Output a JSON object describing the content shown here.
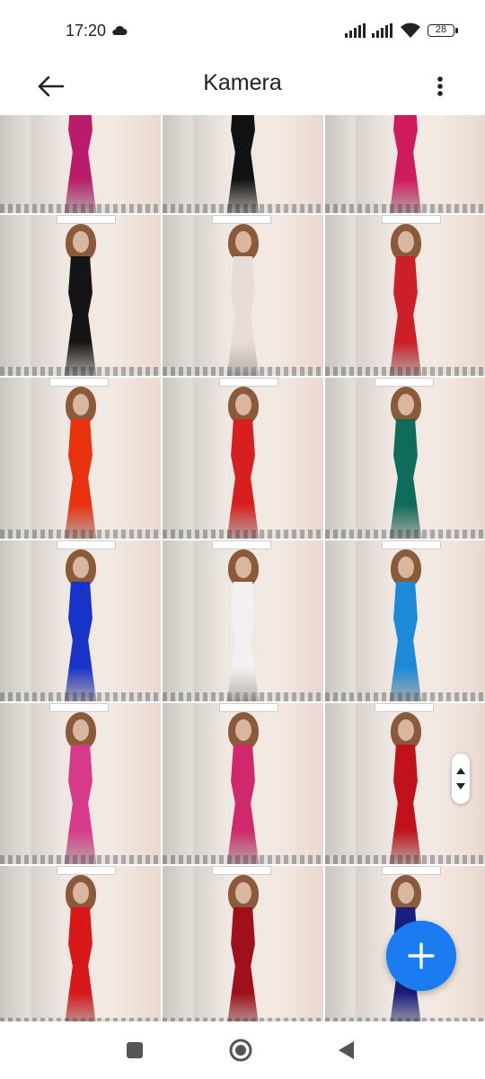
{
  "status_bar": {
    "time": "17:20",
    "battery": "28"
  },
  "app_bar": {
    "title": "Kamera"
  },
  "icons": {
    "back": "arrow-left-icon",
    "more": "more-vertical-icon",
    "cloud": "cloud-icon",
    "signal": "signal-icon",
    "wifi": "wifi-icon",
    "battery": "battery-icon",
    "fab": "plus-icon",
    "scroll": "fast-scroll-icon",
    "nav_recent": "square-icon",
    "nav_home": "circle-icon",
    "nav_back": "triangle-back-icon"
  },
  "colors": {
    "accent": "#1a7cf0"
  },
  "grid": {
    "photos": [
      {
        "dress": "#b81c6a",
        "name": "photo-1"
      },
      {
        "dress": "#111111",
        "name": "photo-2"
      },
      {
        "dress": "#d01a5e",
        "name": "photo-3"
      },
      {
        "dress": "#151515",
        "name": "photo-4"
      },
      {
        "dress": "#e8dcd6",
        "name": "photo-5"
      },
      {
        "dress": "#cc1f28",
        "name": "photo-6"
      },
      {
        "dress": "#e8320e",
        "name": "photo-7"
      },
      {
        "dress": "#d81f1f",
        "name": "photo-8"
      },
      {
        "dress": "#0f6b5a",
        "name": "photo-9"
      },
      {
        "dress": "#1833c8",
        "name": "photo-10"
      },
      {
        "dress": "#f2f0f0",
        "name": "photo-11"
      },
      {
        "dress": "#1c8ad8",
        "name": "photo-12"
      },
      {
        "dress": "#d83a8a",
        "name": "photo-13"
      },
      {
        "dress": "#d0286a",
        "name": "photo-14"
      },
      {
        "dress": "#c0121c",
        "name": "photo-15"
      },
      {
        "dress": "#d81818",
        "name": "photo-16"
      },
      {
        "dress": "#a0101a",
        "name": "photo-17"
      },
      {
        "dress": "#1a2080",
        "name": "photo-18"
      }
    ]
  }
}
